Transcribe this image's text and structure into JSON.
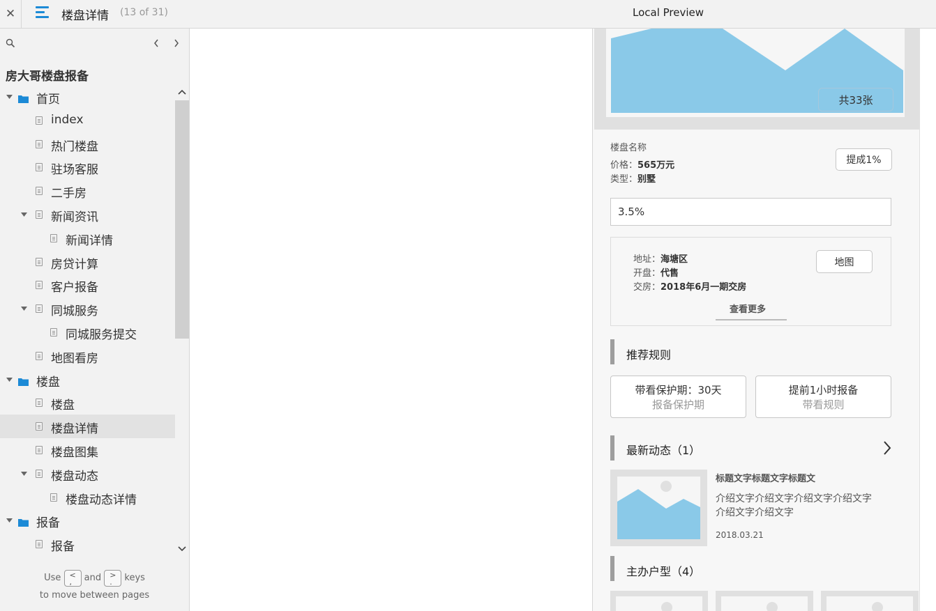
{
  "topbar": {
    "close_glyph": "✕",
    "page_title": "楼盘详情",
    "page_count": "(13 of 31)",
    "preview_title": "Local Preview"
  },
  "sidebar": {
    "project_title": "房大哥楼盘报备",
    "prev_glyph": "‹",
    "next_glyph": "›",
    "items": [
      {
        "label": "首页",
        "type": "folder",
        "level": 0,
        "expanded": true
      },
      {
        "label": "index",
        "type": "page",
        "level": 1
      },
      {
        "label": "热门楼盘",
        "type": "page",
        "level": 1
      },
      {
        "label": "驻场客服",
        "type": "page",
        "level": 1
      },
      {
        "label": "二手房",
        "type": "page",
        "level": 1
      },
      {
        "label": "新闻资讯",
        "type": "page",
        "level": 1,
        "expanded": true
      },
      {
        "label": "新闻详情",
        "type": "page",
        "level": 2
      },
      {
        "label": "房贷计算",
        "type": "page",
        "level": 1
      },
      {
        "label": "客户报备",
        "type": "page",
        "level": 1
      },
      {
        "label": "同城服务",
        "type": "page",
        "level": 1,
        "expanded": true
      },
      {
        "label": "同城服务提交",
        "type": "page",
        "level": 2
      },
      {
        "label": "地图看房",
        "type": "page",
        "level": 1
      },
      {
        "label": "楼盘",
        "type": "folder",
        "level": 0,
        "expanded": true
      },
      {
        "label": "楼盘",
        "type": "page",
        "level": 1
      },
      {
        "label": "楼盘详情",
        "type": "page",
        "level": 1,
        "selected": true
      },
      {
        "label": "楼盘图集",
        "type": "page",
        "level": 1
      },
      {
        "label": "楼盘动态",
        "type": "page",
        "level": 1,
        "expanded": true
      },
      {
        "label": "楼盘动态详情",
        "type": "page",
        "level": 2
      },
      {
        "label": "报备",
        "type": "folder",
        "level": 0,
        "expanded": true
      },
      {
        "label": "报备",
        "type": "page",
        "level": 1
      }
    ],
    "hint": {
      "use": "Use",
      "prev_key": "<\n,",
      "and": "and",
      "next_key": ">\n.",
      "keys": "keys",
      "line2": "to move between pages"
    }
  },
  "preview": {
    "photo_count": "共33张",
    "building_name": "楼盘名称",
    "price_label": "价格：",
    "price_value": "565万元",
    "type_label": "类型：",
    "type_value": "别墅",
    "commission_button": "提成1%",
    "rate_value": "3.5%",
    "address_label": "地址：",
    "address_value": "海塘区",
    "sale_label": "开盘：",
    "sale_value": "代售",
    "delivery_label": "交房：",
    "delivery_value": "2018年6月一期交房",
    "map_button": "地图",
    "more_link": "查看更多",
    "rules_title": "推荐规则",
    "rules": [
      {
        "main": "带看保护期：30天",
        "sub": "报备保护期"
      },
      {
        "main": "提前1小时报备",
        "sub": "带看规则"
      }
    ],
    "news_title": "最新动态（1）",
    "news_item": {
      "headline": "标题文字标题文字标题文",
      "intro_line1": "介绍文字介绍文字介绍文字介绍文字",
      "intro_line2": "介绍文字介绍文字",
      "date": "2018.03.21"
    },
    "units_title": "主办户型（4）"
  },
  "colors": {
    "accent": "#1c8ad6",
    "image_blue": "#8ac9e8",
    "placeholder_gray": "#e0e0e0"
  }
}
